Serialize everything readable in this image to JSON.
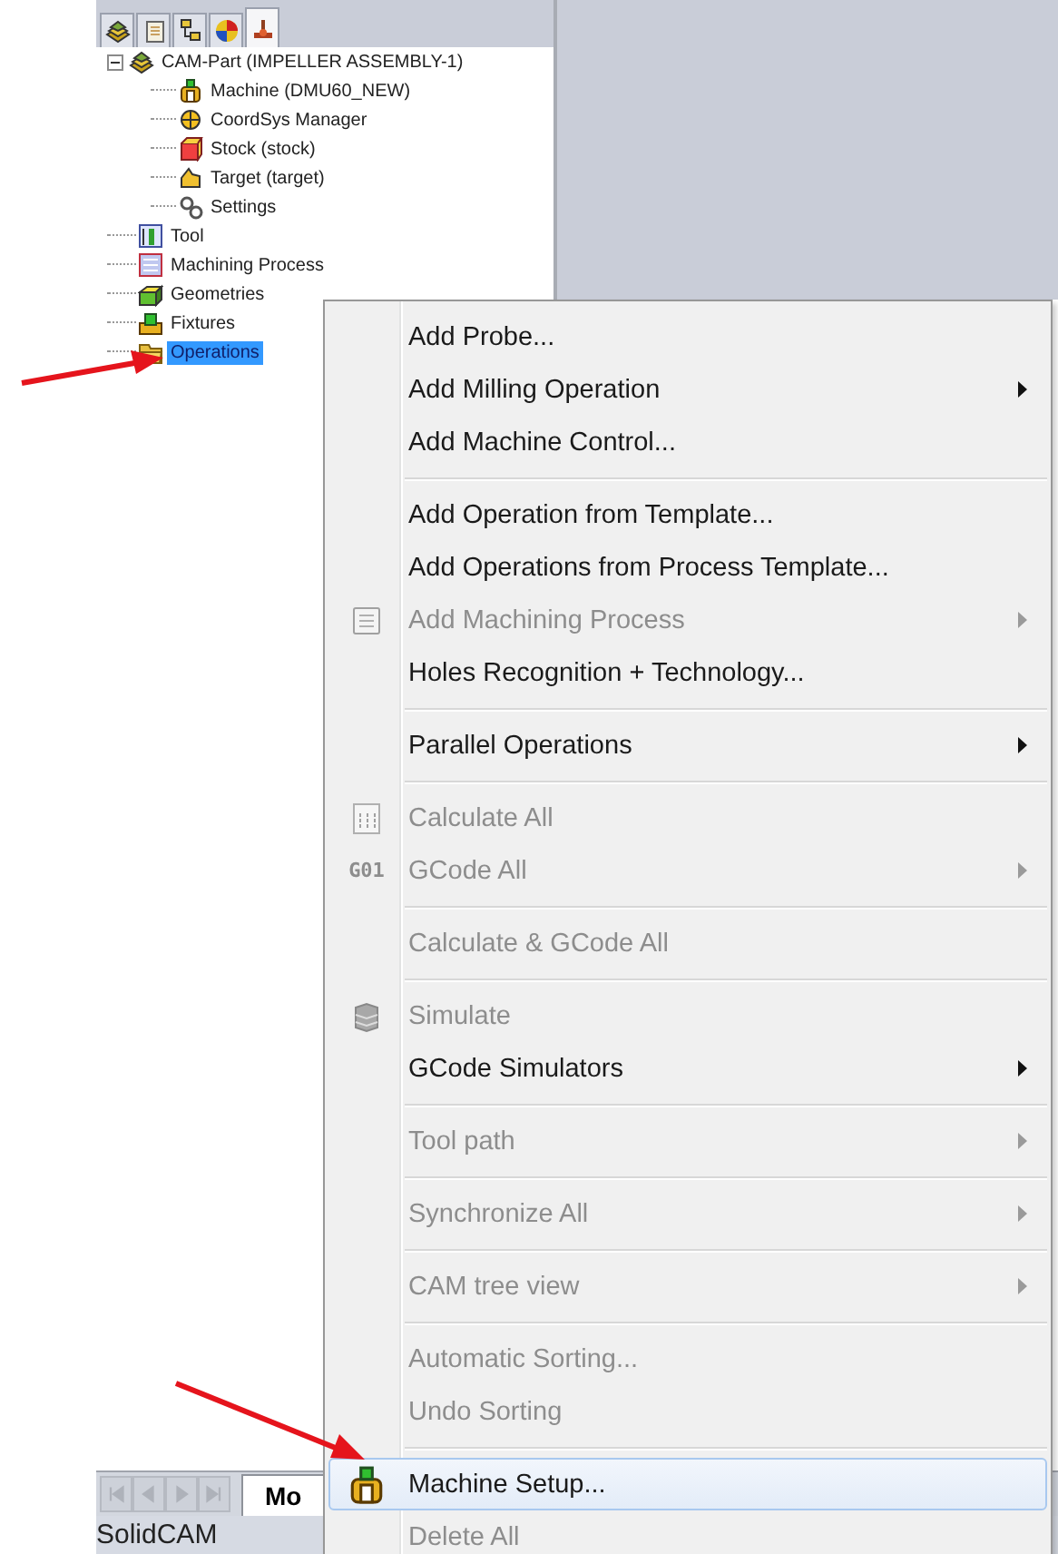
{
  "tree_tabs": [
    {
      "selected": false
    },
    {
      "selected": false
    },
    {
      "selected": false
    },
    {
      "selected": false
    },
    {
      "selected": true
    }
  ],
  "tree": [
    {
      "label": "CAM-Part (IMPELLER ASSEMBLY-1)",
      "expanded": true,
      "selected": false,
      "children": [
        {
          "label": "Machine (DMU60_NEW)",
          "selected": false
        },
        {
          "label": "CoordSys Manager",
          "selected": false
        },
        {
          "label": "Stock (stock)",
          "selected": false
        },
        {
          "label": "Target (target)",
          "selected": false
        },
        {
          "label": "Settings",
          "selected": false
        }
      ]
    },
    {
      "label": "Tool",
      "selected": false
    },
    {
      "label": "Machining Process",
      "selected": false
    },
    {
      "label": "Geometries",
      "selected": false
    },
    {
      "label": "Fixtures",
      "selected": false
    },
    {
      "label": "Operations",
      "selected": true
    }
  ],
  "context_menu": [
    {
      "kind": "item",
      "label": "Add Probe...",
      "disabled": false,
      "submenu": false,
      "selected": false
    },
    {
      "kind": "item",
      "label": "Add Milling Operation",
      "disabled": false,
      "submenu": true,
      "selected": false
    },
    {
      "kind": "item",
      "label": "Add Machine Control...",
      "disabled": false,
      "submenu": false,
      "selected": false
    },
    {
      "kind": "separator"
    },
    {
      "kind": "item",
      "label": "Add Operation from Template...",
      "disabled": false,
      "submenu": false,
      "selected": false
    },
    {
      "kind": "item",
      "label": "Add Operations from Process Template...",
      "disabled": false,
      "submenu": false,
      "selected": false
    },
    {
      "kind": "item",
      "label": "Add Machining Process",
      "disabled": true,
      "submenu": true,
      "selected": false
    },
    {
      "kind": "item",
      "label": "Holes Recognition + Technology...",
      "disabled": false,
      "submenu": false,
      "selected": false
    },
    {
      "kind": "separator"
    },
    {
      "kind": "item",
      "label": "Parallel Operations",
      "disabled": false,
      "submenu": true,
      "selected": false
    },
    {
      "kind": "separator"
    },
    {
      "kind": "item",
      "label": "Calculate All",
      "disabled": true,
      "submenu": false,
      "selected": false
    },
    {
      "kind": "item",
      "label": "GCode All",
      "disabled": true,
      "submenu": true,
      "selected": false,
      "icon_text": "G01"
    },
    {
      "kind": "separator"
    },
    {
      "kind": "item",
      "label": "Calculate & GCode All",
      "disabled": true,
      "submenu": false,
      "selected": false
    },
    {
      "kind": "separator"
    },
    {
      "kind": "item",
      "label": "Simulate",
      "disabled": true,
      "submenu": false,
      "selected": false
    },
    {
      "kind": "item",
      "label": "GCode Simulators",
      "disabled": false,
      "submenu": true,
      "selected": false
    },
    {
      "kind": "separator"
    },
    {
      "kind": "item",
      "label": "Tool path",
      "disabled": true,
      "submenu": true,
      "selected": false
    },
    {
      "kind": "separator"
    },
    {
      "kind": "item",
      "label": "Synchronize All",
      "disabled": true,
      "submenu": true,
      "selected": false
    },
    {
      "kind": "separator"
    },
    {
      "kind": "item",
      "label": "CAM tree view",
      "disabled": true,
      "submenu": true,
      "selected": false
    },
    {
      "kind": "separator"
    },
    {
      "kind": "item",
      "label": "Automatic Sorting...",
      "disabled": true,
      "submenu": false,
      "selected": false
    },
    {
      "kind": "item",
      "label": "Undo Sorting",
      "disabled": true,
      "submenu": false,
      "selected": false
    },
    {
      "kind": "separator"
    },
    {
      "kind": "item",
      "label": "Machine Setup...",
      "disabled": false,
      "submenu": false,
      "selected": true
    },
    {
      "kind": "item",
      "label": "Delete All",
      "disabled": true,
      "submenu": false,
      "selected": false
    }
  ],
  "bottom_tabs": [
    {
      "label": "Mo",
      "selected": true
    }
  ],
  "status_bar": "SolidCAM"
}
